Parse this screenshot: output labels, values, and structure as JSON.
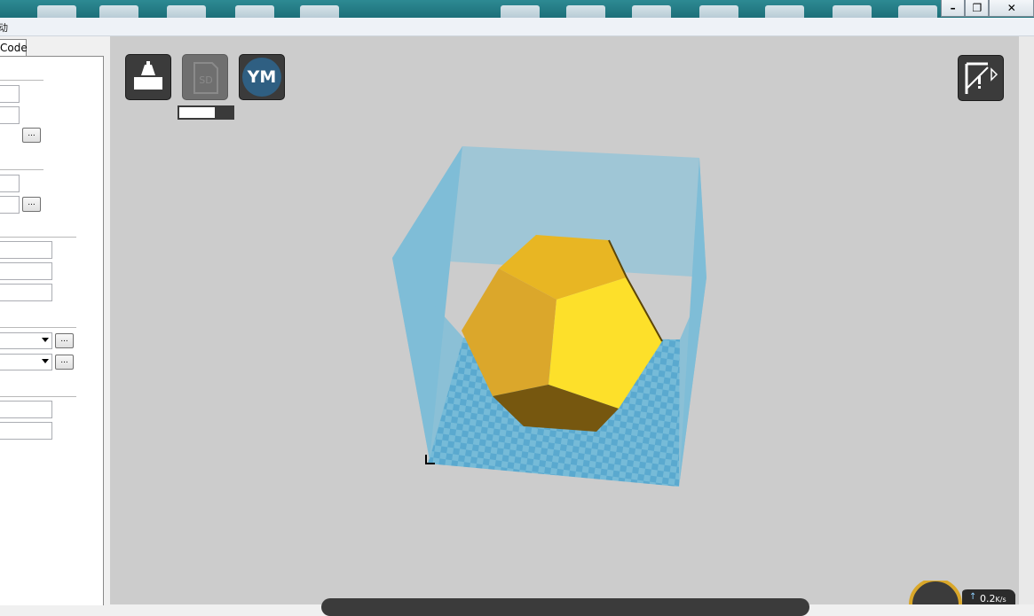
{
  "window": {
    "controls": {
      "minimize": "–",
      "maximize": "❐",
      "close": "✕"
    }
  },
  "menubar": {
    "partial_glyph": "动"
  },
  "left_panel": {
    "tab_label": "Code",
    "browse_button_label": "...",
    "combo_button_label": "..."
  },
  "toolbar": {
    "load_icon": "load-model-icon",
    "sd_icon": "sd-card-icon",
    "sd_label": "SD",
    "ym_label": "YM",
    "view_icon": "view-mode-icon",
    "progress_fraction": 0.66
  },
  "scene": {
    "model": "dodecahedron",
    "model_colors": {
      "top": "#e8b623",
      "left": "#dba72b",
      "right": "#fde02a",
      "bottom": "#76570f"
    },
    "build_volume_color": "#7ec3dc"
  },
  "tray": {
    "net_value": "0.2",
    "net_unit": "K/s",
    "up_arrow": "↑"
  }
}
